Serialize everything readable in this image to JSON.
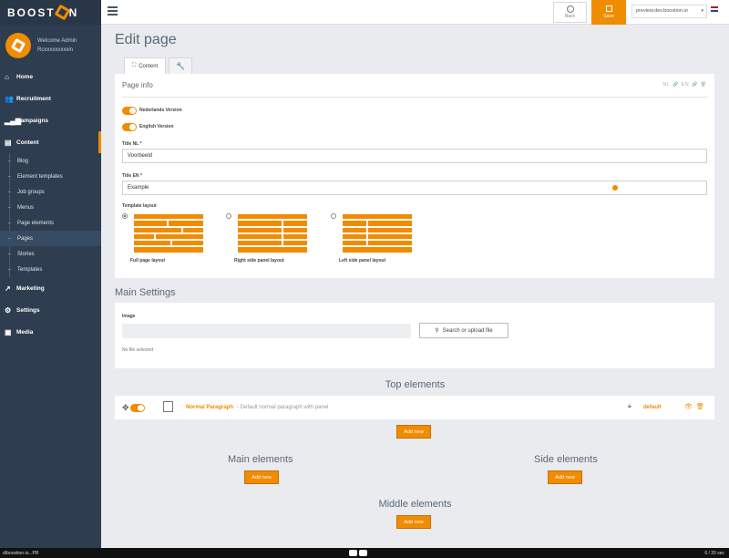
{
  "brand": {
    "name_left": "BOOST",
    "name_right": "N"
  },
  "user": {
    "welcome": "Welcome Admin",
    "name": "Rcxxxxxxxxxin"
  },
  "nav": {
    "home": "Home",
    "recruitment": "Recruitment",
    "campaigns": "Campaigns",
    "content": "Content",
    "content_items": [
      "Blog",
      "Element templates",
      "Job groups",
      "Menus",
      "Page elements",
      "Pages",
      "Stories",
      "Templates"
    ],
    "marketing": "Marketing",
    "settings": "Settings",
    "media": "Media"
  },
  "topbar": {
    "back_label": "Back",
    "save_label": "Save",
    "preview_value": "preview.dev.boostion.io"
  },
  "page": {
    "title": "Edit page",
    "tab_content": "Content",
    "page_info": "Page info",
    "head_tools": "NL 🔗 EN 🔗 🗑",
    "toggle_nl": "Nederlands Version",
    "toggle_en": "English Version",
    "title_nl_label": "Title NL *",
    "title_nl_value": "Voorbeeld",
    "title_en_label": "Title EN *",
    "title_en_value": "Example",
    "template_layout_label": "Template layout",
    "layouts": [
      "Full page layout",
      "Right side panel layout",
      "Left side panel layout"
    ]
  },
  "main_settings": {
    "title": "Main Settings",
    "image_label": "Image",
    "upload_label": "Search or upload file",
    "no_file": "No file selected"
  },
  "top_elements": {
    "title": "Top elements",
    "row": {
      "name": "Normal Paragraph",
      "desc": "- Default normal paragraph with panel",
      "status": "default"
    },
    "add_label": "Add new"
  },
  "main_elements": {
    "title": "Main elements",
    "add_label": "Add new"
  },
  "side_elements": {
    "title": "Side elements",
    "add_label": "Add new"
  },
  "middle_elements": {
    "title": "Middle elements",
    "add_label": "Add new"
  },
  "bottombar": {
    "left": "d/boostion.io...PR",
    "right": "6 / 20 sec"
  },
  "colors": {
    "accent": "#f08c00",
    "sidebar": "#2e3d4f"
  }
}
